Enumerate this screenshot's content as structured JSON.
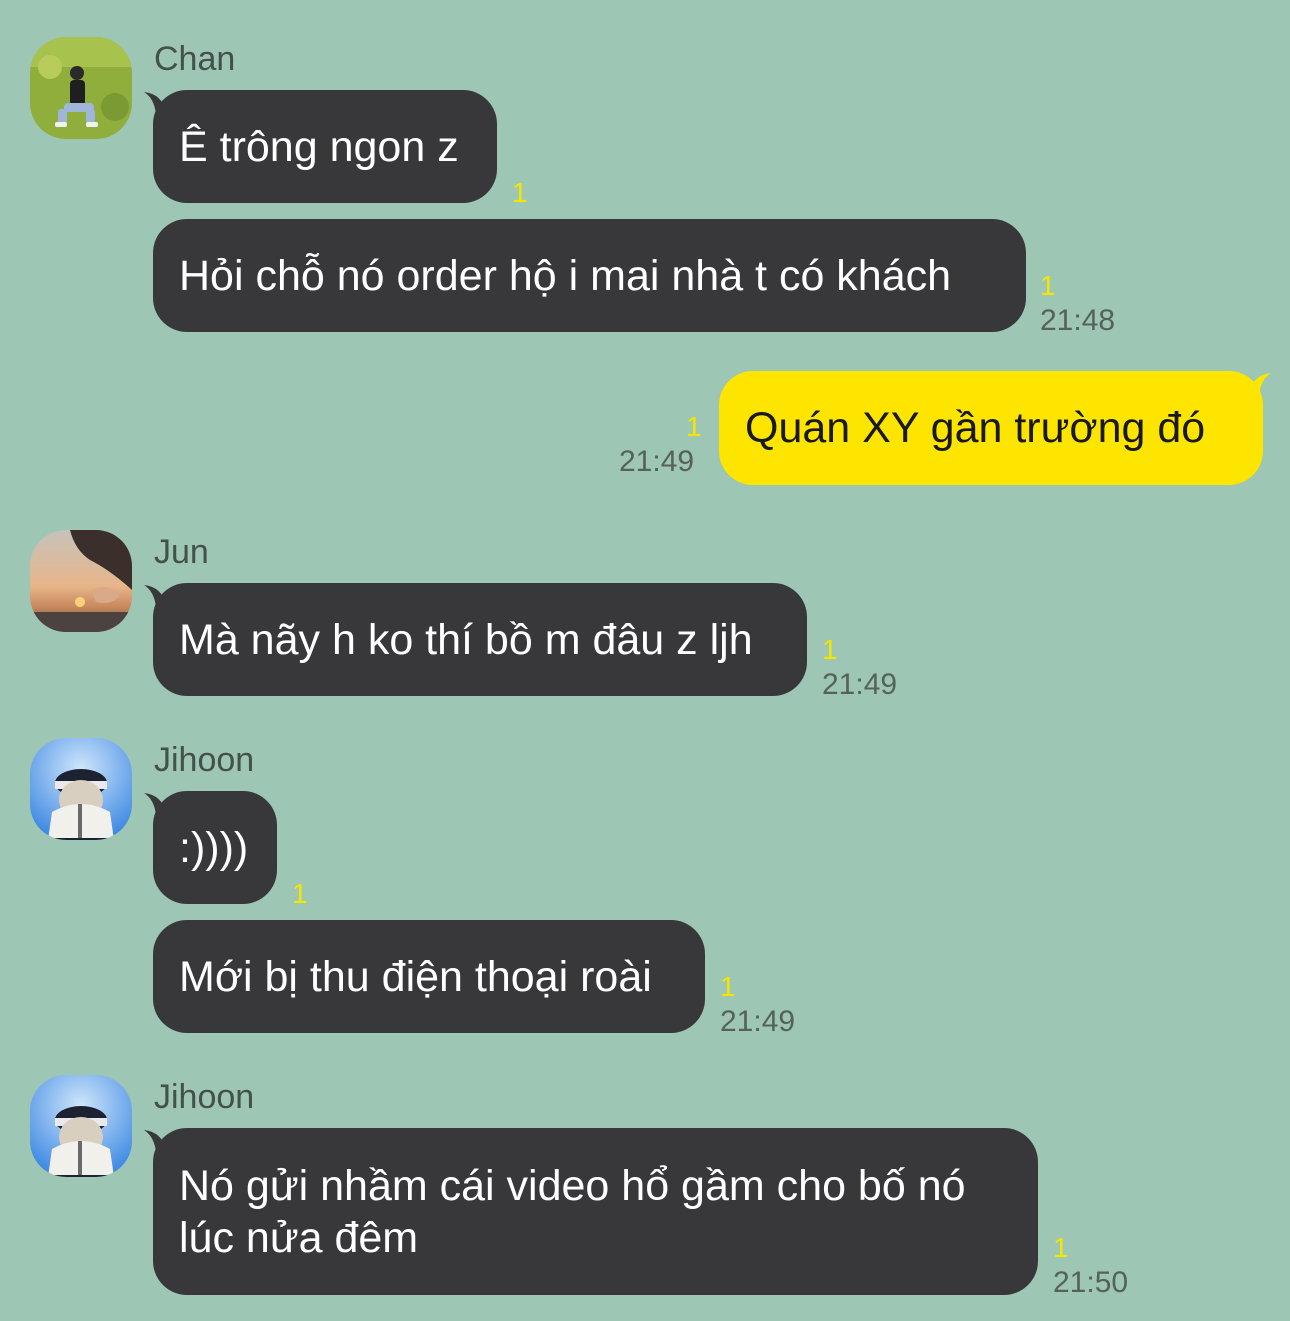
{
  "colors": {
    "background": "#9dc6b4",
    "incoming_bubble": "#38383b",
    "outgoing_bubble": "#fee500",
    "unread_count": "#f5e600"
  },
  "messages": [
    {
      "sender": "Chan",
      "bubbles": [
        {
          "text": "Ê trông ngon z",
          "unread": "1"
        },
        {
          "text": "Hỏi chỗ nó order hộ i mai nhà t có khách",
          "unread": "1",
          "time": "21:48"
        }
      ]
    },
    {
      "sender": "me",
      "bubbles": [
        {
          "text": "Quán XY gần trường đó",
          "unread": "1",
          "time": "21:49"
        }
      ]
    },
    {
      "sender": "Jun",
      "bubbles": [
        {
          "text": "Mà nãy h ko thí bồ m đâu z ljh",
          "unread": "1",
          "time": "21:49"
        }
      ]
    },
    {
      "sender": "Jihoon",
      "bubbles": [
        {
          "text": ":))))",
          "unread": "1"
        },
        {
          "text": "Mới bị thu điện thoại roài",
          "unread": "1",
          "time": "21:49"
        }
      ]
    },
    {
      "sender": "Jihoon",
      "bubbles": [
        {
          "text": "Nó gửi nhầm cái video hổ gầm cho bố nó lúc nửa đêm",
          "unread": "1",
          "time": "21:50"
        }
      ]
    }
  ]
}
